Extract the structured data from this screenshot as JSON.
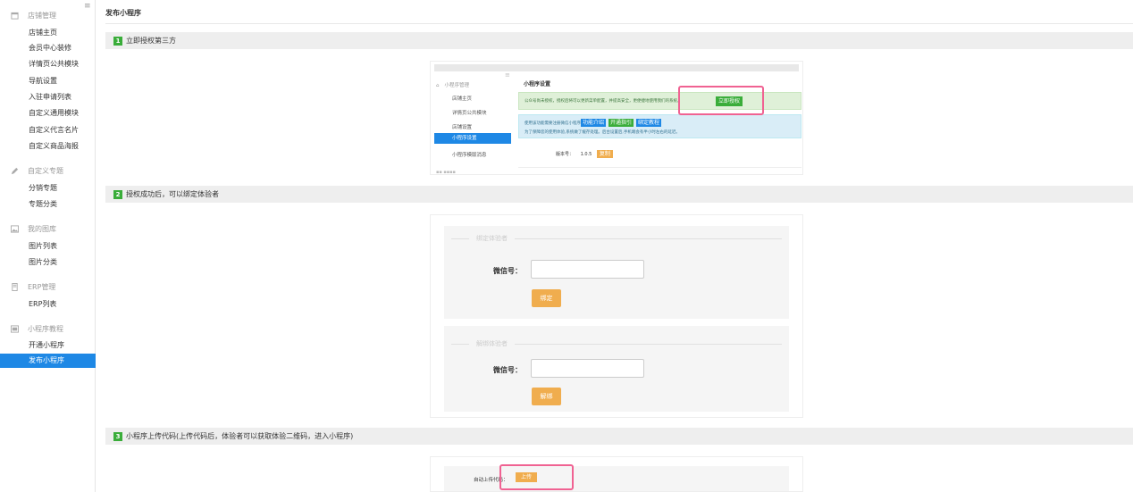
{
  "sidebar": {
    "groups": [
      {
        "label": "店铺管理",
        "icon": "store-icon",
        "items": [
          "店铺主页",
          "会员中心装修",
          "详情页公共模块",
          "导航设置",
          "入驻申请列表",
          "自定义通用模块",
          "自定义代言名片",
          "自定义商品海报"
        ]
      },
      {
        "label": "自定义专题",
        "icon": "pencil-icon",
        "items": [
          "分销专题",
          "专题分类"
        ]
      },
      {
        "label": "我的图库",
        "icon": "image-icon",
        "items": [
          "图片列表",
          "图片分类"
        ]
      },
      {
        "label": "ERP管理",
        "icon": "erp-icon",
        "items": [
          "ERP列表"
        ]
      },
      {
        "label": "小程序教程",
        "icon": "miniapp-icon",
        "items": [
          "开通小程序",
          "发布小程序"
        ]
      }
    ],
    "active": "发布小程序"
  },
  "page": {
    "title": "发布小程序",
    "steps": [
      {
        "num": "1",
        "label": "立即授权第三方"
      },
      {
        "num": "2",
        "label": "授权成功后，可以绑定体验者"
      },
      {
        "num": "3",
        "label": "小程序上传代码(上传代码后，体验者可以获取体验二维码，进入小程序)"
      }
    ]
  },
  "shot1": {
    "menu_title": "小程序管理",
    "menu_items": [
      "店铺主页",
      "详情页公共模块",
      "店铺设置",
      "小程序设置",
      "小程序模版消息"
    ],
    "menu_active": "小程序设置",
    "heading": "小程序设置",
    "auth_text": "公众号尚未授权，授权后将可以更新菜单配置，并提高安全，更便捷地使用我们的系统。",
    "auth_button": "立即授权",
    "info_line1": "使用该功能需要注册微信小程序。",
    "btn_intro": "功能介绍",
    "btn_open": "开通指引",
    "btn_bind": "绑定教程",
    "info_line2": "为了保障您的使用体验,系统做了缓存处理。后台设置后,手机端会有半小时左右的延迟。",
    "version_label": "版本号：",
    "version_value": "1.0.5",
    "version_btn": "复制"
  },
  "shot2": {
    "bind_legend": "绑定体验者",
    "wechat_label": "微信号：",
    "bind_button": "绑定",
    "unbind_legend": "解绑体验者",
    "unbind_button": "解绑"
  },
  "shot3": {
    "upload_label": "自动上传代码：",
    "upload_button": "上传"
  }
}
